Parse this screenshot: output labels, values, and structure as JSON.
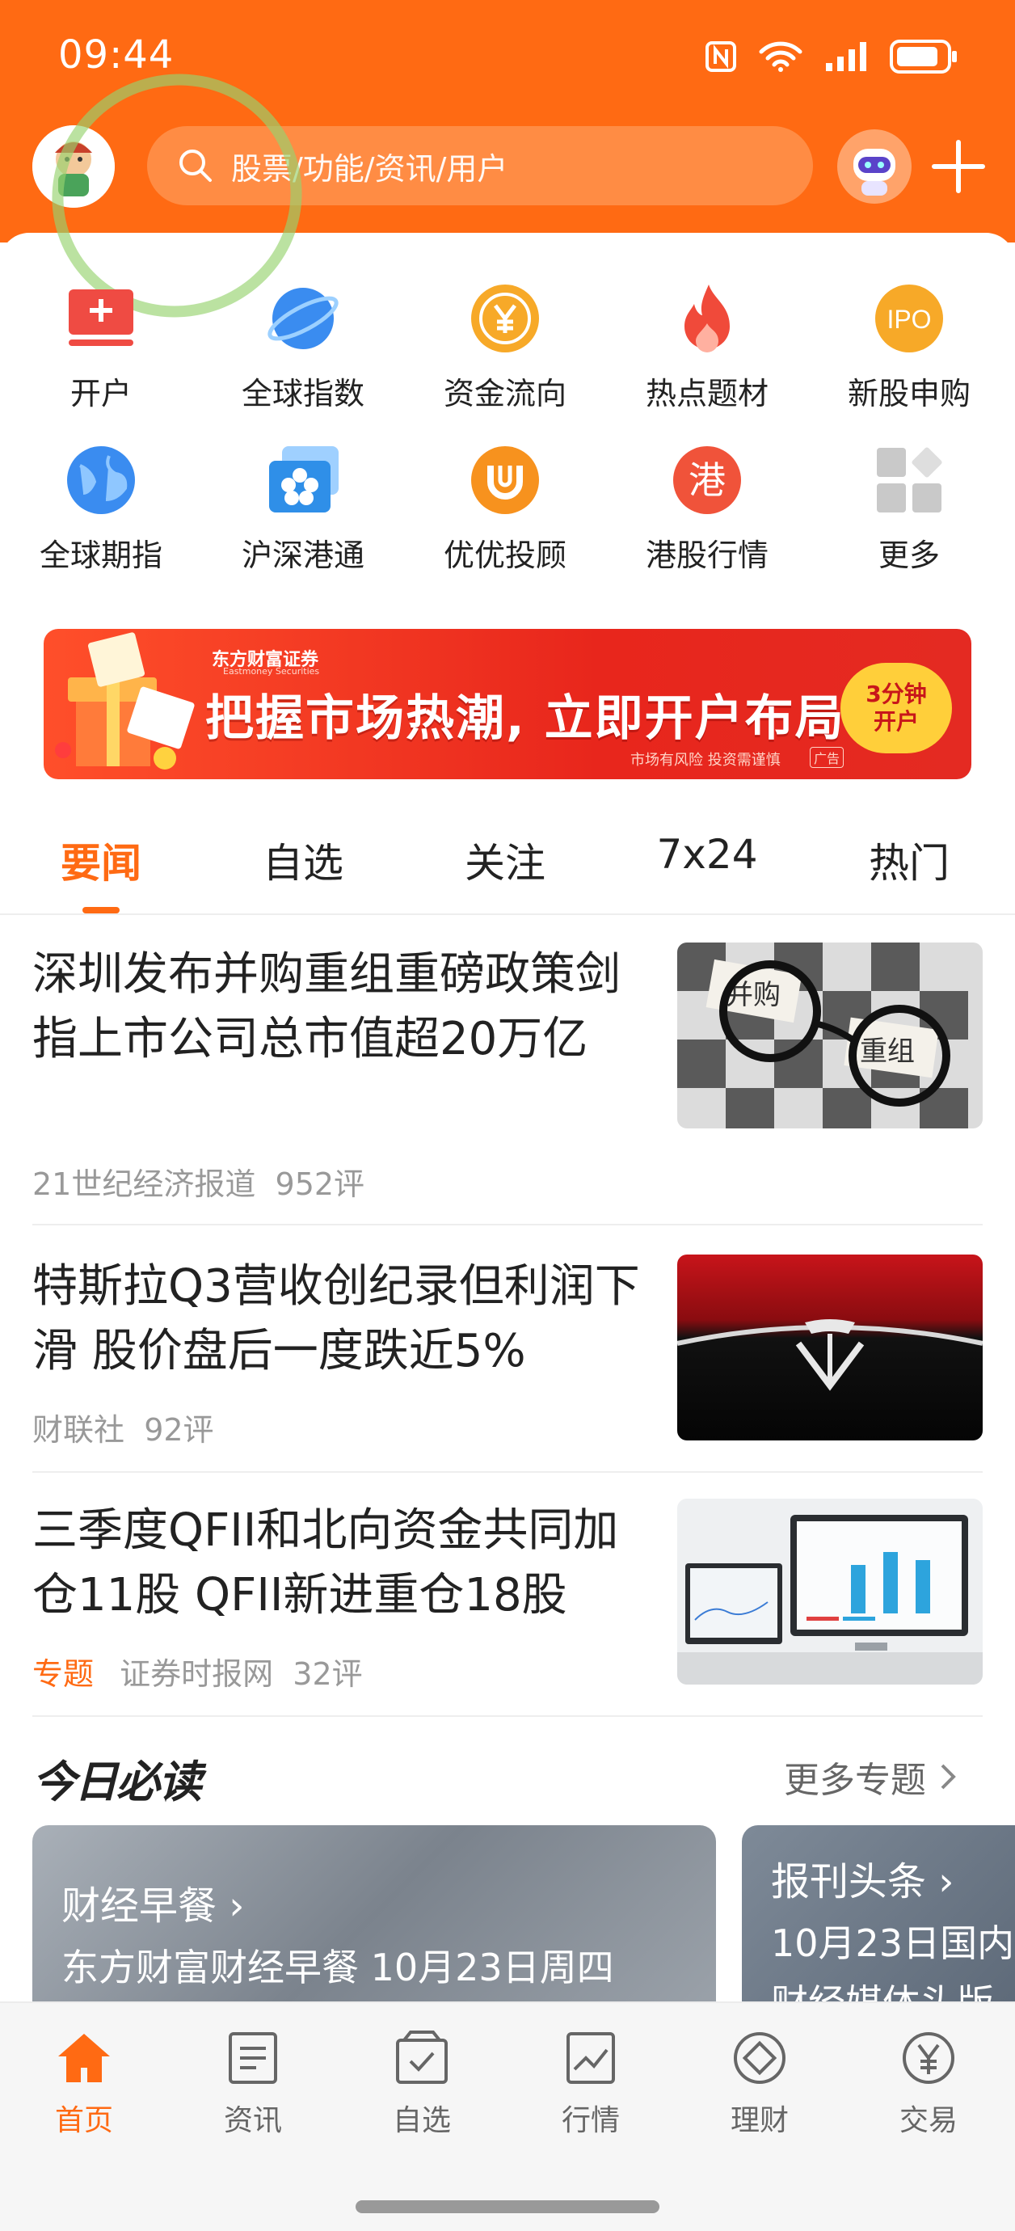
{
  "status_bar": {
    "time": "09:44"
  },
  "search": {
    "placeholder": "股票/功能/资讯/用户"
  },
  "grid": {
    "row1": [
      {
        "label": "开户",
        "icon": "open-account-icon"
      },
      {
        "label": "全球指数",
        "icon": "planet-icon"
      },
      {
        "label": "资金流向",
        "icon": "yuan-coin-icon"
      },
      {
        "label": "热点题材",
        "icon": "flame-icon"
      },
      {
        "label": "新股申购",
        "icon": "ipo-icon"
      }
    ],
    "row2": [
      {
        "label": "全球期指",
        "icon": "globe-icon"
      },
      {
        "label": "沪深港通",
        "icon": "bauhinia-icon"
      },
      {
        "label": "优优投顾",
        "icon": "advisor-icon"
      },
      {
        "label": "港股行情",
        "icon": "hk-icon"
      },
      {
        "label": "更多",
        "icon": "more-grid-icon"
      }
    ],
    "ipo_text": "IPO",
    "hk_text": "港"
  },
  "banner": {
    "brand": "东方财富证券",
    "brand_en": "Eastmoney Securities",
    "slogan": "把握市场热潮, 立即开户布局",
    "risk": "市场有风险 投资需谨慎",
    "ad_tag": "广告",
    "badge_line1": "3分钟",
    "badge_line2": "开户"
  },
  "tabs": [
    "要闻",
    "自选",
    "关注",
    "7x24",
    "热门"
  ],
  "news": [
    {
      "title": "深圳发布并购重组重磅政策剑指上市公司总市值超20万亿",
      "source": "21世纪经济报道",
      "comments": "952评",
      "thumb_text1": "并购",
      "thumb_text2": "重组"
    },
    {
      "title": "特斯拉Q3营收创纪录但利润下滑 股价盘后一度跌近5%",
      "source": "财联社",
      "comments": "92评"
    },
    {
      "title": "三季度QFII和北向资金共同加仓11股 QFII新进重仓18股",
      "tag": "专题",
      "source": "证券时报网",
      "comments": "32评"
    }
  ],
  "must_read": {
    "title": "今日必读",
    "more": "更多专题",
    "cards": [
      {
        "title": "财经早餐",
        "subtitle": "东方财富财经早餐 10月23日周四"
      },
      {
        "title": "报刊头条",
        "subtitle": "10月23日国内",
        "subtitle2": "财经媒体头版"
      }
    ]
  },
  "bottom_nav": [
    {
      "label": "首页",
      "icon": "home-icon",
      "active": true
    },
    {
      "label": "资讯",
      "icon": "news-icon"
    },
    {
      "label": "自选",
      "icon": "watchlist-icon"
    },
    {
      "label": "行情",
      "icon": "market-chart-icon"
    },
    {
      "label": "理财",
      "icon": "wealth-icon"
    },
    {
      "label": "交易",
      "icon": "trade-icon"
    }
  ],
  "colors": {
    "brand": "#ff6a13",
    "banner_red": "#e8261c"
  }
}
